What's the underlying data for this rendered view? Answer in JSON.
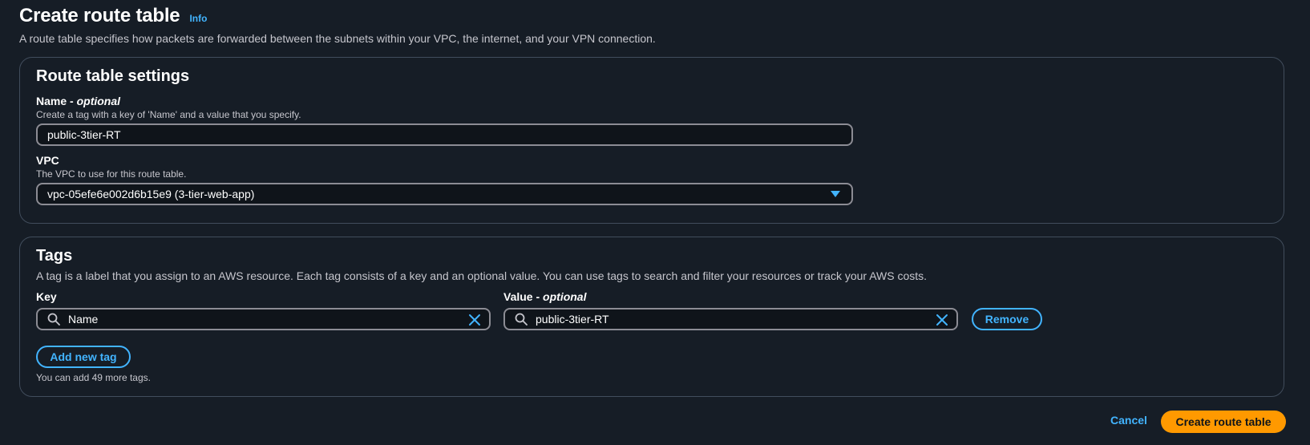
{
  "header": {
    "title": "Create route table",
    "info_label": "Info",
    "description": "A route table specifies how packets are forwarded between the subnets within your VPC, the internet, and your VPN connection."
  },
  "settings": {
    "title": "Route table settings",
    "name_label": "Name",
    "name_optional": "optional",
    "name_hint": "Create a tag with a key of 'Name' and a value that you specify.",
    "name_value": "public-3tier-RT",
    "vpc_label": "VPC",
    "vpc_hint": "The VPC to use for this route table.",
    "vpc_value": "vpc-05efe6e002d6b15e9 (3-tier-web-app)"
  },
  "tags": {
    "title": "Tags",
    "description": "A tag is a label that you assign to an AWS resource. Each tag consists of a key and an optional value. You can use tags to search and filter your resources or track your AWS costs.",
    "key_label": "Key",
    "value_label": "Value",
    "value_optional": "optional",
    "rows": [
      {
        "key": "Name",
        "value": "public-3tier-RT"
      }
    ],
    "remove_label": "Remove",
    "add_label": "Add new tag",
    "remaining_note": "You can add 49 more tags."
  },
  "footer": {
    "cancel_label": "Cancel",
    "create_label": "Create route table"
  },
  "colors": {
    "accent": "#42b4ff",
    "primary": "#ff9900",
    "background": "#161d26"
  },
  "icons": {
    "search": "search-icon",
    "clear": "close-icon",
    "dropdown": "caret-down-icon"
  }
}
